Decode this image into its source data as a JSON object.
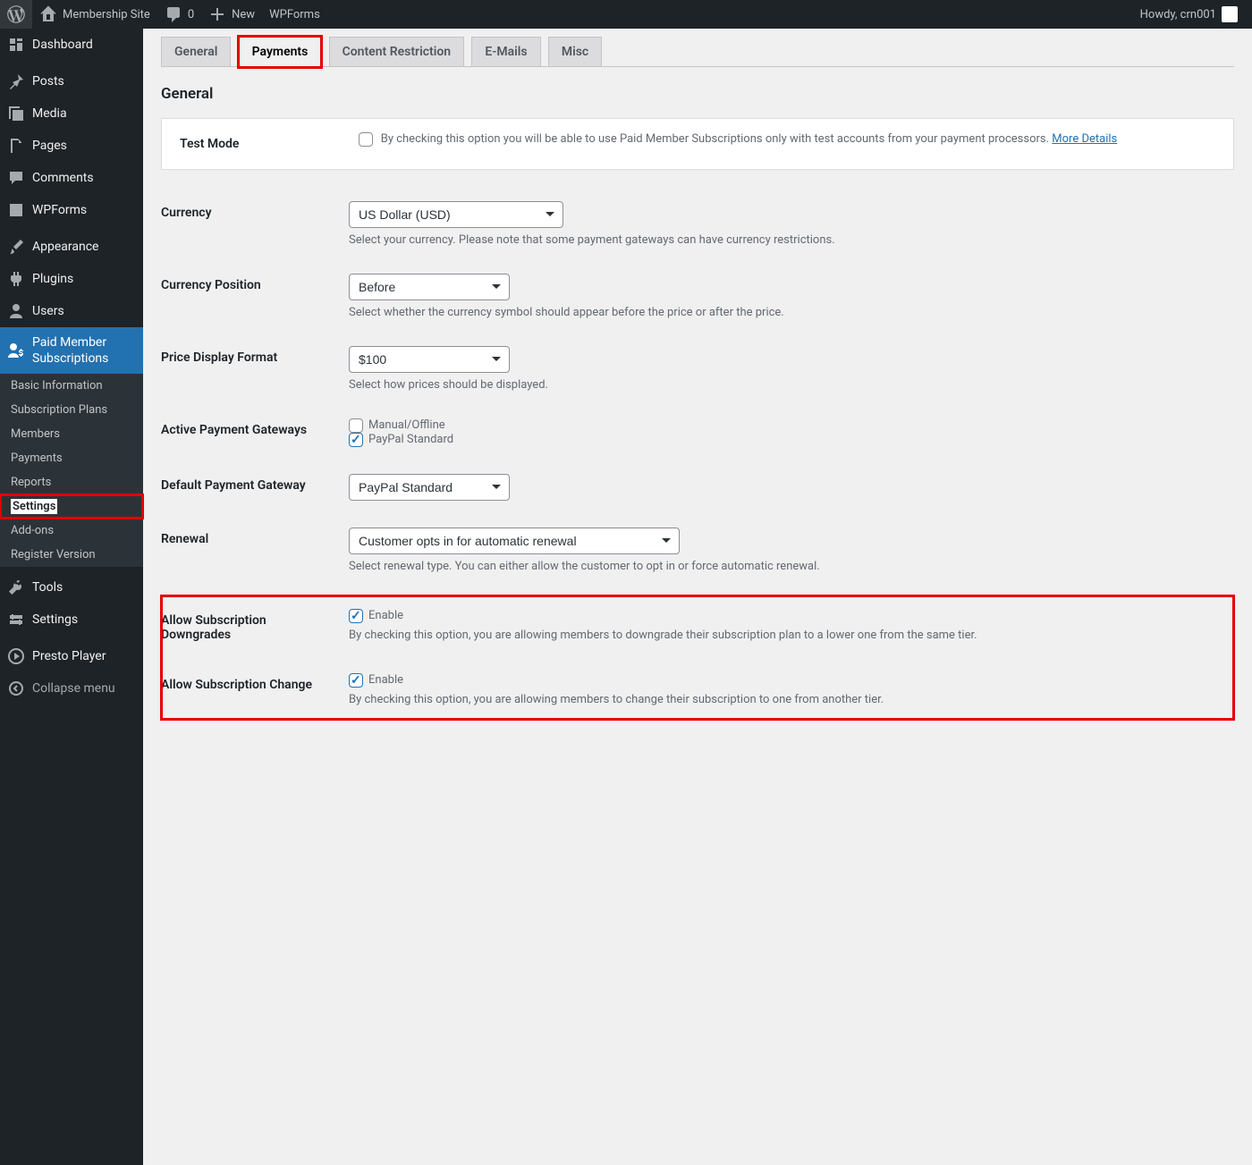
{
  "adminbar": {
    "site_name": "Membership Site",
    "comments": "0",
    "new": "New",
    "wpforms": "WPForms",
    "howdy": "Howdy, crn001"
  },
  "sidebar": {
    "items": [
      {
        "label": "Dashboard",
        "icon": "dashboard"
      },
      {
        "label": "Posts",
        "icon": "pin"
      },
      {
        "label": "Media",
        "icon": "media"
      },
      {
        "label": "Pages",
        "icon": "page"
      },
      {
        "label": "Comments",
        "icon": "comment"
      },
      {
        "label": "WPForms",
        "icon": "wpforms"
      },
      {
        "label": "Appearance",
        "icon": "brush"
      },
      {
        "label": "Plugins",
        "icon": "plugin"
      },
      {
        "label": "Users",
        "icon": "user"
      },
      {
        "label": "Paid Member Subscriptions",
        "icon": "pms-user"
      }
    ],
    "submenu": [
      "Basic Information",
      "Subscription Plans",
      "Members",
      "Payments",
      "Reports",
      "Settings",
      "Add-ons",
      "Register Version"
    ],
    "after": [
      {
        "label": "Tools",
        "icon": "tools"
      },
      {
        "label": "Settings",
        "icon": "settings"
      },
      {
        "label": "Presto Player",
        "icon": "presto"
      },
      {
        "label": "Collapse menu",
        "icon": "collapse"
      }
    ]
  },
  "tabs": [
    "General",
    "Payments",
    "Content Restriction",
    "E-Mails",
    "Misc"
  ],
  "page": {
    "section_title": "General",
    "test_mode": {
      "label": "Test Mode",
      "desc": "By checking this option you will be able to use Paid Member Subscriptions only with test accounts from your payment processors. ",
      "link": "More Details"
    },
    "currency": {
      "label": "Currency",
      "value": "US Dollar (USD)",
      "desc": "Select your currency. Please note that some payment gateways can have currency restrictions."
    },
    "currency_position": {
      "label": "Currency Position",
      "value": "Before",
      "desc": "Select whether the currency symbol should appear before the price or after the price."
    },
    "price_format": {
      "label": "Price Display Format",
      "value": "$100",
      "desc": "Select how prices should be displayed."
    },
    "gateways": {
      "label": "Active Payment Gateways",
      "opt1": "Manual/Offline",
      "opt2": "PayPal Standard"
    },
    "default_gateway": {
      "label": "Default Payment Gateway",
      "value": "PayPal Standard"
    },
    "renewal": {
      "label": "Renewal",
      "value": "Customer opts in for automatic renewal",
      "desc": "Select renewal type. You can either allow the customer to opt in or force automatic renewal."
    },
    "downgrades": {
      "label": "Allow Subscription Downgrades",
      "enable": "Enable",
      "desc": "By checking this option, you are allowing members to downgrade their subscription plan to a lower one from the same tier."
    },
    "change": {
      "label": "Allow Subscription Change",
      "enable": "Enable",
      "desc": "By checking this option, you are allowing members to change their subscription to one from another tier."
    }
  }
}
